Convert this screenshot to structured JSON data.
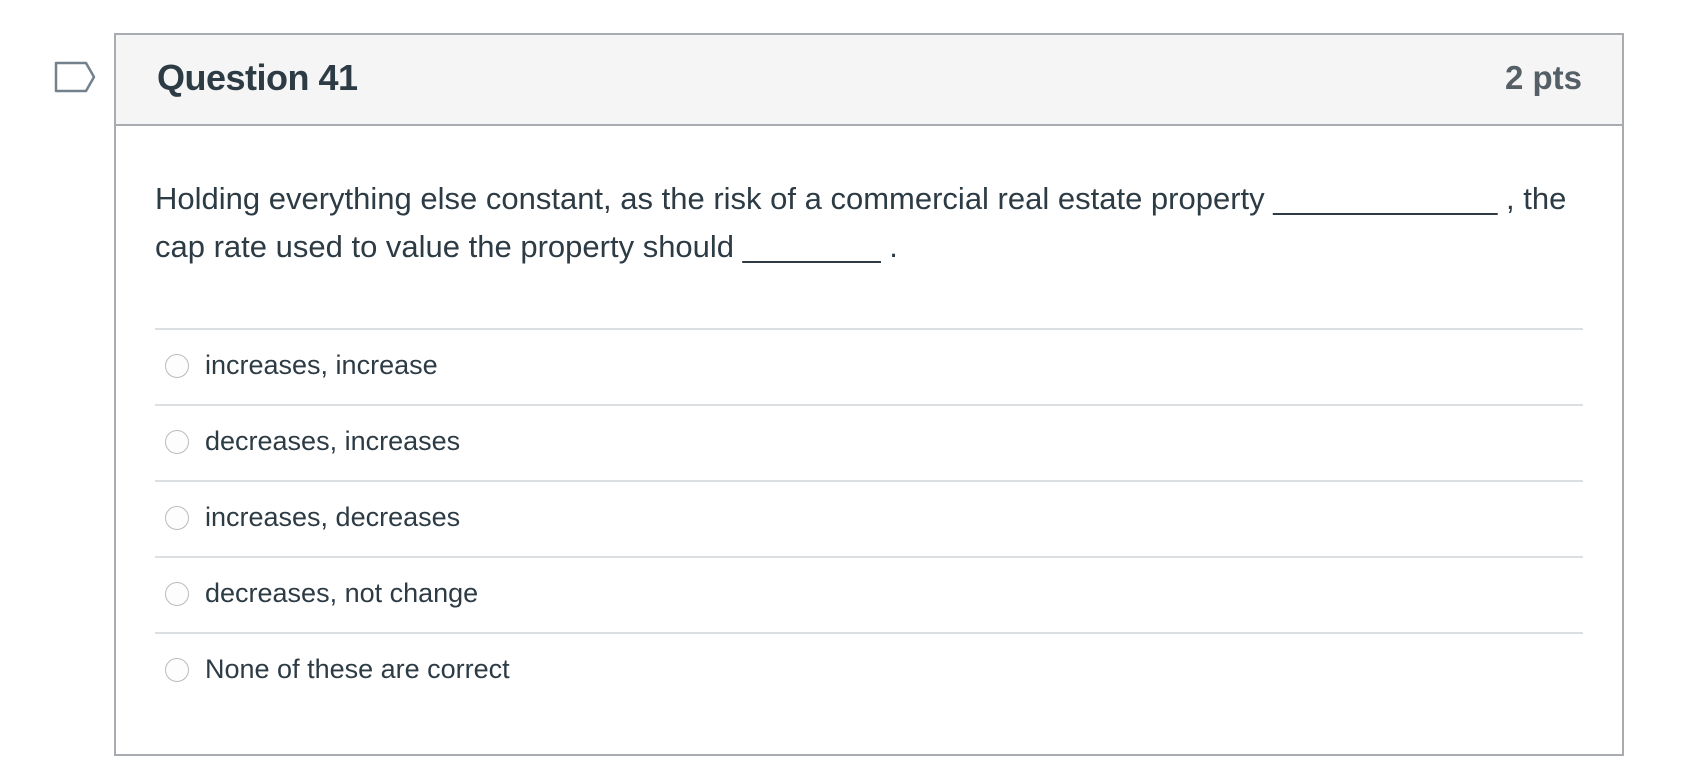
{
  "question": {
    "title": "Question 41",
    "points": "2 pts",
    "text_line1": "Holding everything else constant, as the risk of a commercial real estate property _____________ , the",
    "text_line2": "cap rate used to value the property should ________ .",
    "answers": [
      {
        "label": "increases, increase",
        "selected": false
      },
      {
        "label": "decreases, increases",
        "selected": false
      },
      {
        "label": "increases, decreases",
        "selected": false
      },
      {
        "label": "decreases, not change",
        "selected": false
      },
      {
        "label": "None of these are correct",
        "selected": false
      }
    ]
  },
  "icons": {
    "flag": "flag-question-icon"
  },
  "colors": {
    "text": "#2d3b45",
    "header_bg": "#f5f5f5",
    "border": "#a8acb0",
    "divider": "#dcdfe1",
    "flag": "#73818c"
  }
}
